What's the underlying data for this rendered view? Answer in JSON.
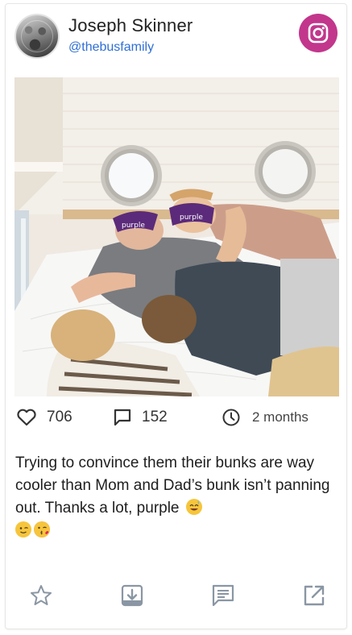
{
  "profile": {
    "name": "Joseph Skinner",
    "handle": "@thebusfamily",
    "platform_icon": "instagram-icon",
    "platform_color": "#c2368c"
  },
  "post": {
    "image_alt": "Family sleeping on a bed wearing purple eye masks",
    "mask_text_1": "purple",
    "mask_text_2": "purple"
  },
  "stats": {
    "likes": "706",
    "comments": "152",
    "time": "2 months"
  },
  "caption": {
    "text": "Trying to convince them their bunks are way cooler than Mom and Dad’s bunk isn’t panning out. Thanks a lot, purple",
    "emojis": [
      "grinning-sweat-emoji",
      "winking-emoji",
      "kissing-emoji"
    ]
  },
  "actions": [
    "star-icon",
    "download-icon",
    "comment-icon",
    "external-link-icon"
  ],
  "colors": {
    "link": "#2f6fd6",
    "icon": "#8a96a3",
    "accent": "#c2368c"
  }
}
